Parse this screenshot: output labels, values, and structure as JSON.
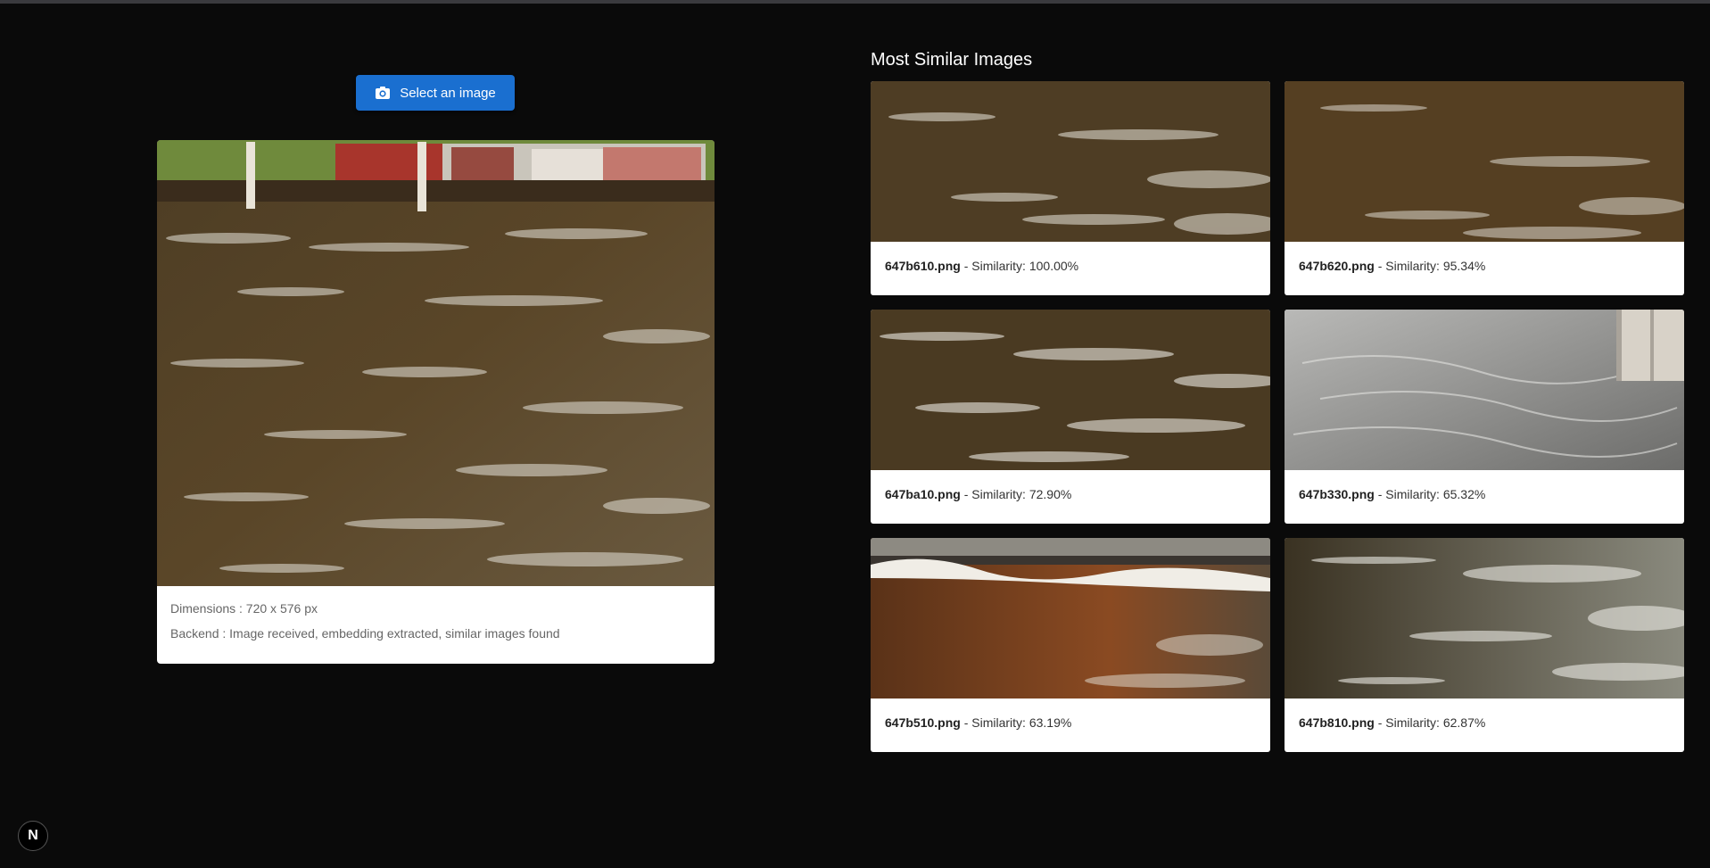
{
  "upload": {
    "button_label": "Select an image",
    "icon": "camera-icon"
  },
  "preview": {
    "dimensions_text": "Dimensions : 720 x 576 px",
    "backend_text": "Backend : Image received, embedding extracted, similar images found"
  },
  "similar": {
    "title": "Most Similar Images",
    "separator": " - ",
    "similarity_prefix": "Similarity: ",
    "results": [
      {
        "filename": "647b610.png",
        "similarity": "100.00%"
      },
      {
        "filename": "647b620.png",
        "similarity": "95.34%"
      },
      {
        "filename": "647ba10.png",
        "similarity": "72.90%"
      },
      {
        "filename": "647b330.png",
        "similarity": "65.32%"
      },
      {
        "filename": "647b510.png",
        "similarity": "63.19%"
      },
      {
        "filename": "647b810.png",
        "similarity": "62.87%"
      }
    ]
  },
  "dev_badge": {
    "label": "N",
    "icon": "nextjs-logo-icon"
  },
  "colors": {
    "background": "#0a0a0a",
    "accent": "#1a6fd0",
    "card": "#ffffff",
    "water_brown": "#4a3a22"
  }
}
